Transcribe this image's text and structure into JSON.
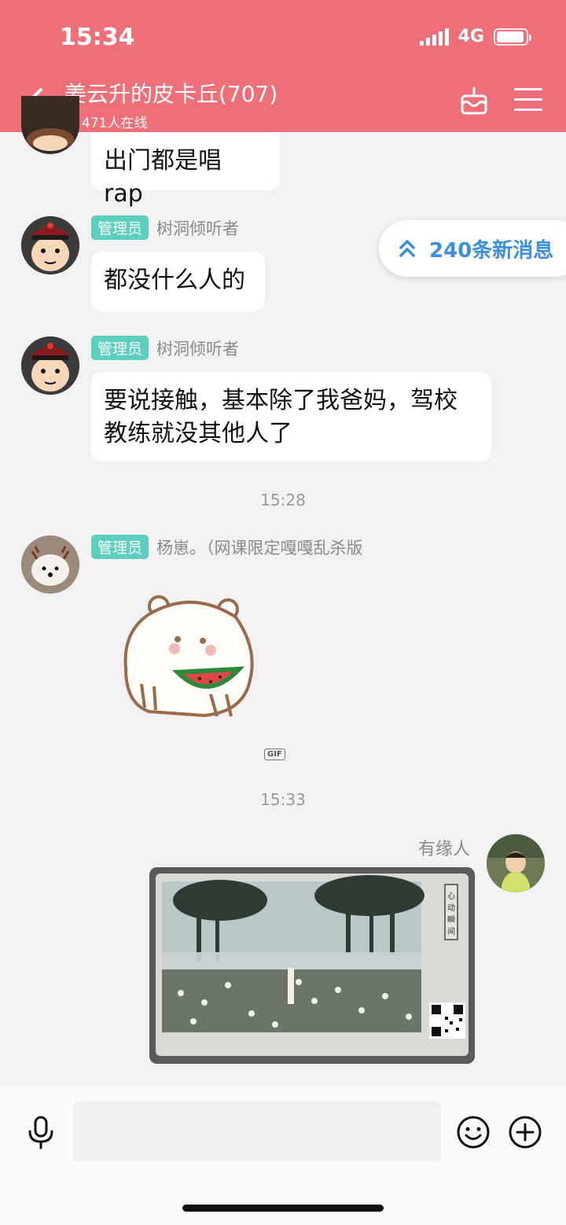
{
  "status": {
    "time": "15:34",
    "network": "4G"
  },
  "header": {
    "title": "姜云升的皮卡丘(707)",
    "online_count": "471人在线",
    "icons": [
      "back-icon",
      "cake-icon",
      "menu-icon"
    ]
  },
  "new_messages": {
    "label": "240条新消息"
  },
  "messages": [
    {
      "text": "出门都是唱 rap"
    },
    {
      "badge": "管理员",
      "sender": "树洞倾听者",
      "text": "都没什么人的"
    },
    {
      "badge": "管理员",
      "sender": "树洞倾听者",
      "text": "要说接触，基本除了我爸妈，驾校教练就没其他人了"
    },
    {
      "badge": "管理员",
      "sender": "杨崽。（网课限定嘎嘎乱杀版",
      "sticker": "hamster-watermelon-gif",
      "gif_label": "GIF"
    },
    {
      "sender": "有缘人",
      "image": "game-screenshot-qr-card",
      "image_text": "心动瞬间"
    }
  ],
  "time_dividers": [
    "15:28",
    "15:33"
  ],
  "input": {
    "placeholder": "",
    "icons": [
      "mic-icon",
      "emoji-icon",
      "plus-icon"
    ]
  },
  "colors": {
    "header_bg": "#ee6f78",
    "badge_bg": "#5ccfbf",
    "new_msg_text": "#3a8fe0",
    "chat_bg": "#f2f2f3"
  }
}
